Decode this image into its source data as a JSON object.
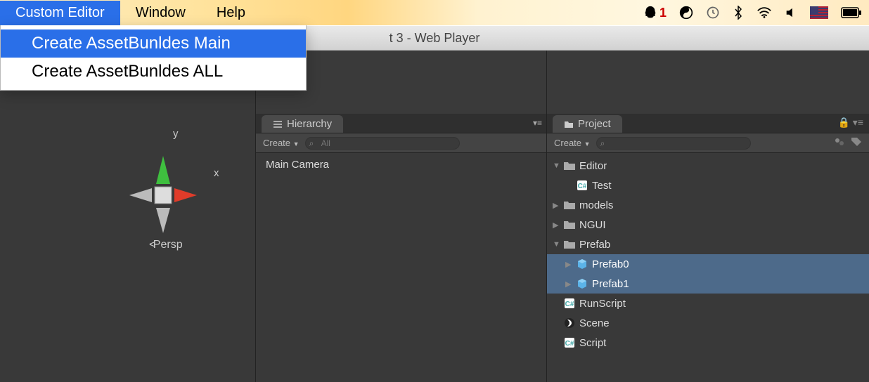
{
  "menubar": {
    "items": [
      "Custom Editor",
      "Window",
      "Help"
    ],
    "active_index": 0,
    "status": {
      "penguin_badge": "1"
    }
  },
  "dropdown": {
    "items": [
      "Create AssetBunldes Main",
      "Create AssetBunldes ALL"
    ],
    "highlight_index": 0
  },
  "titlebar": {
    "text": "t 3 - Web Player"
  },
  "scene": {
    "axis_x": "x",
    "axis_y": "y",
    "persp": "Persp"
  },
  "hierarchy": {
    "tab_label": "Hierarchy",
    "create_label": "Create",
    "search_placeholder": "All",
    "items": [
      "Main Camera"
    ]
  },
  "project": {
    "tab_label": "Project",
    "create_label": "Create",
    "search_placeholder": "",
    "tree": [
      {
        "name": "Editor",
        "type": "folder",
        "expanded": true,
        "depth": 0
      },
      {
        "name": "Test",
        "type": "script",
        "depth": 1
      },
      {
        "name": "models",
        "type": "folder",
        "expanded": false,
        "depth": 0
      },
      {
        "name": "NGUI",
        "type": "folder",
        "expanded": false,
        "depth": 0
      },
      {
        "name": "Prefab",
        "type": "folder",
        "expanded": true,
        "depth": 0
      },
      {
        "name": "Prefab0",
        "type": "prefab",
        "selected": true,
        "depth": 1
      },
      {
        "name": "Prefab1",
        "type": "prefab",
        "selected": true,
        "depth": 1
      },
      {
        "name": "RunScript",
        "type": "script",
        "depth": 0
      },
      {
        "name": "Scene",
        "type": "scene",
        "depth": 0
      },
      {
        "name": "Script",
        "type": "script",
        "depth": 0
      }
    ]
  }
}
